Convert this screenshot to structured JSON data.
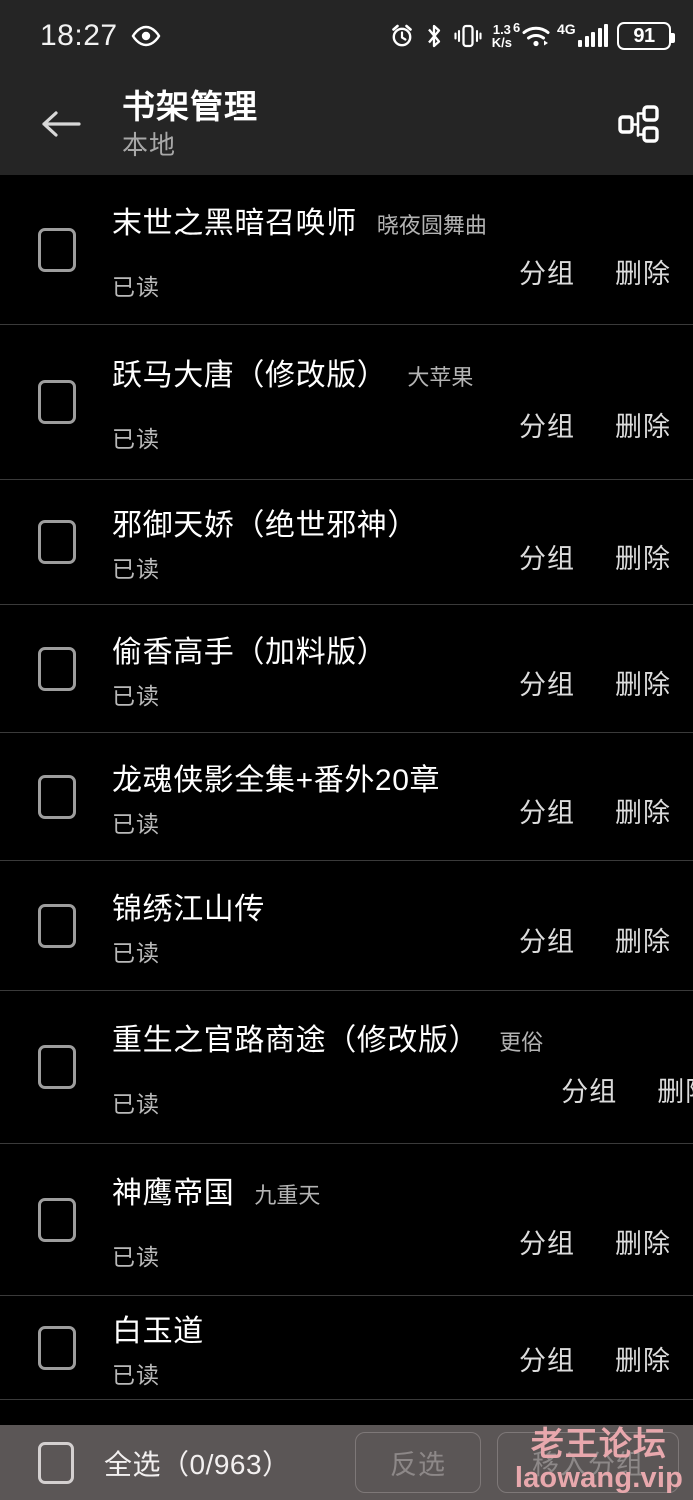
{
  "status_bar": {
    "time": "18:27",
    "eye_icon": "eye-icon",
    "alarm_icon": "alarm-clock-icon",
    "bluetooth_icon": "bluetooth-icon",
    "vibrate_icon": "vibrate-icon",
    "net_speed_value": "1.3",
    "net_speed_unit": "K/s",
    "wifi_generation": "6",
    "wifi_icon": "wifi-icon",
    "mobile_network": "4G",
    "signal_icon": "signal-bars-icon",
    "battery_level": "91"
  },
  "header": {
    "back_icon": "arrow-left-icon",
    "title": "书架管理",
    "subtitle": "本地",
    "hierarchy_icon": "hierarchy-icon"
  },
  "list": {
    "action_group_label": "分组",
    "action_delete_label": "删除",
    "items": [
      {
        "title": "末世之黑暗召唤师",
        "author": "晓夜圆舞曲",
        "status": "已读"
      },
      {
        "title": "跃马大唐（修改版）",
        "author": "大苹果",
        "status": "已读"
      },
      {
        "title": "邪御天娇（绝世邪神）",
        "author": "",
        "status": "已读"
      },
      {
        "title": "偷香高手（加料版）",
        "author": "",
        "status": "已读"
      },
      {
        "title": "龙魂侠影全集+番外20章",
        "author": "",
        "status": "已读"
      },
      {
        "title": "锦绣江山传",
        "author": "",
        "status": "已读"
      },
      {
        "title": "重生之官路商途（修改版）",
        "author": "更俗",
        "status": "已读"
      },
      {
        "title": "神鹰帝国",
        "author": "九重天",
        "status": "已读"
      },
      {
        "title": "白玉道",
        "author": "",
        "status": "已读"
      }
    ]
  },
  "bottom_bar": {
    "select_all_label": "全选（0/963）",
    "invert_label": "反选",
    "move_to_group_label": "移入分组"
  },
  "watermark": {
    "line1": "老王论坛",
    "line2": "laowang.vip",
    "color": "#e8a8ad"
  },
  "colors": {
    "header_bg": "#252525",
    "list_bg": "#000000",
    "divider": "#3a3a3a",
    "bottom_bar_bg": "#5b5656",
    "text_primary": "#ffffff",
    "text_secondary": "#b4b4b4"
  }
}
